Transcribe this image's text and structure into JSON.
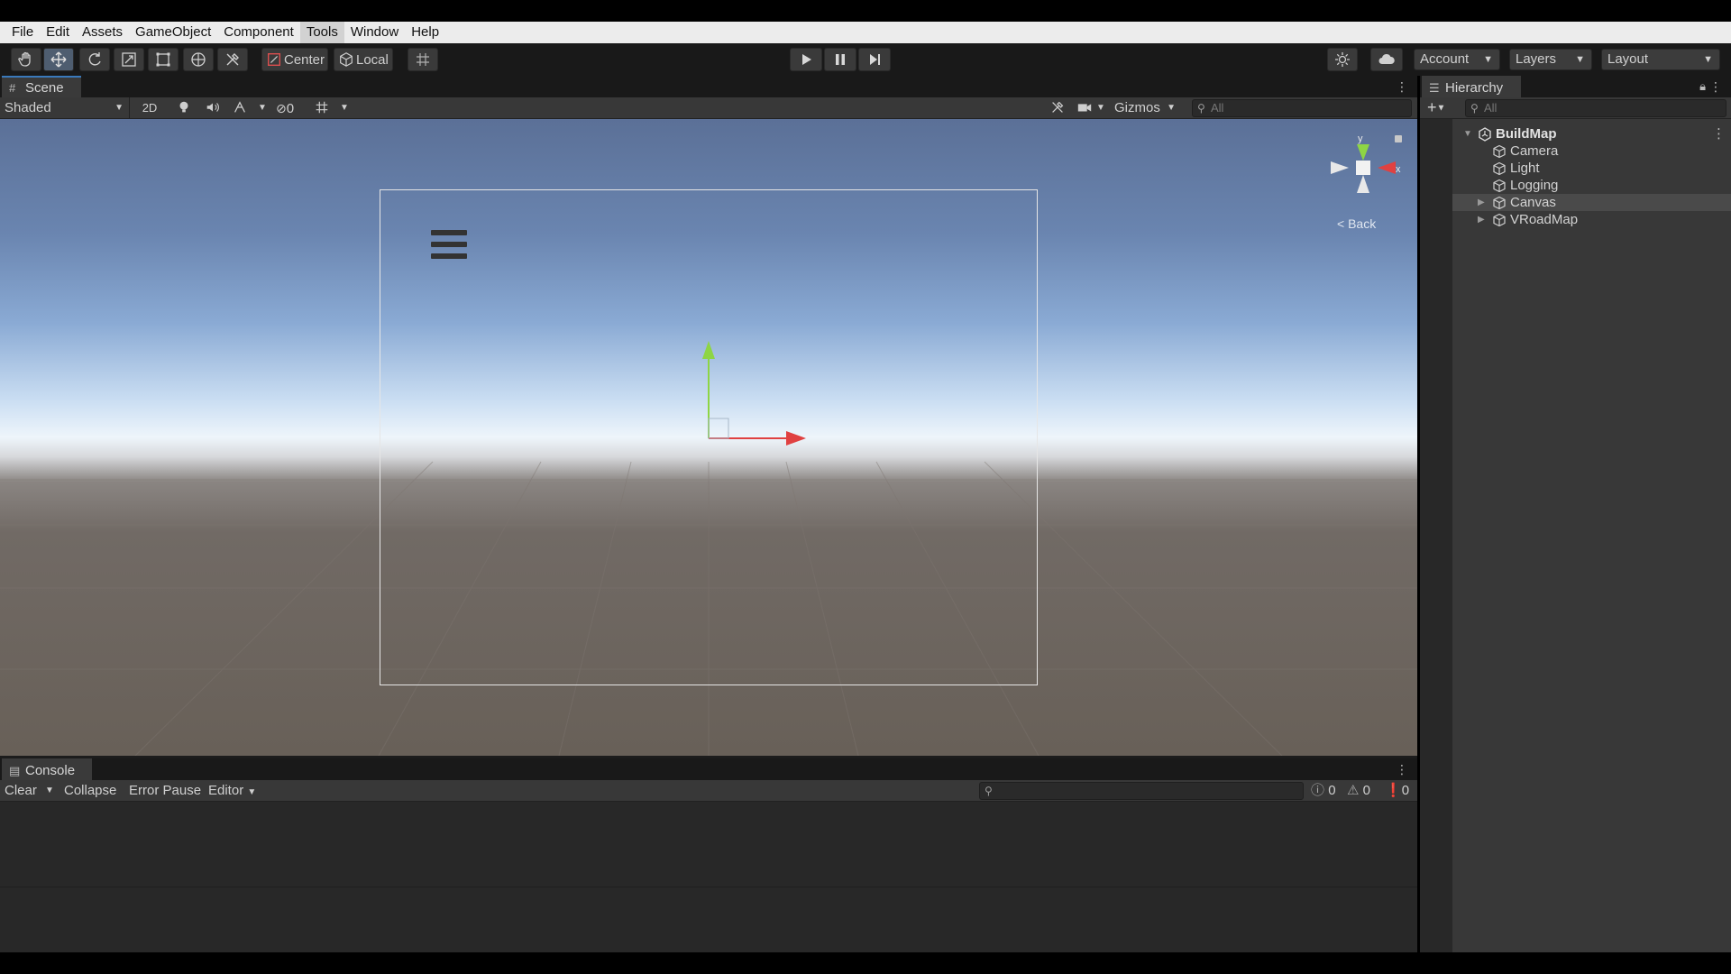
{
  "menubar": {
    "items": [
      "File",
      "Edit",
      "Assets",
      "GameObject",
      "Component",
      "Tools",
      "Window",
      "Help"
    ],
    "active": "Tools"
  },
  "toolbar": {
    "tools": [
      "hand-tool-icon",
      "move-tool-icon",
      "rotate-tool-icon",
      "scale-tool-icon",
      "rect-tool-icon",
      "transform-tool-icon",
      "custom-tool-icon"
    ],
    "pivot_label": "Center",
    "space_label": "Local",
    "account_label": "Account",
    "layers_label": "Layers",
    "layout_label": "Layout"
  },
  "scene": {
    "tab_label": "Scene",
    "shading_mode": "Shaded",
    "mode_2d": "2D",
    "hidden_count": "0",
    "gizmos_label": "Gizmos",
    "search_placeholder": "All",
    "back_label": "< Back",
    "axis_y": "y",
    "axis_x": "x"
  },
  "console": {
    "tab_label": "Console",
    "clear_label": "Clear",
    "collapse_label": "Collapse",
    "error_pause_label": "Error Pause",
    "editor_label": "Editor",
    "info_count": "0",
    "warning_count": "0",
    "error_count": "0"
  },
  "hierarchy": {
    "tab_label": "Hierarchy",
    "search_placeholder": "All",
    "root": "BuildMap",
    "items": [
      {
        "label": "Camera",
        "expandable": false
      },
      {
        "label": "Light",
        "expandable": false
      },
      {
        "label": "Logging",
        "expandable": false
      },
      {
        "label": "Canvas",
        "expandable": true
      },
      {
        "label": "VRoadMap",
        "expandable": true
      }
    ],
    "selected": "Canvas"
  },
  "colors": {
    "accent_blue": "#3a79bb",
    "axis_x_red": "#e04141",
    "axis_y_green": "#8ed544",
    "panel_bg": "#282828"
  }
}
